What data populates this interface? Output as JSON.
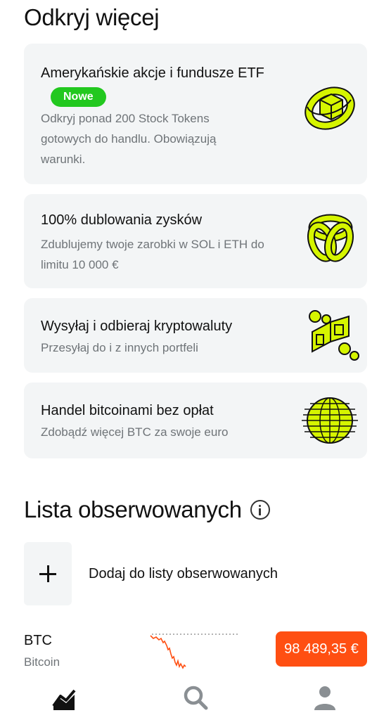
{
  "discover": {
    "title": "Odkryj więcej",
    "cards": [
      {
        "title": "Amerykańskie akcje i fundusze ETF",
        "badge": "Nowe",
        "description": "Odkryj ponad 200 Stock Tokens gotowych do handlu. Obowiązują warunki.",
        "icon": "cube-ring-icon"
      },
      {
        "title": "100% dublowania zysków",
        "description": "Zdublujemy twoje zarobki w SOL i ETH do limitu 10 000 €",
        "icon": "knot-icon"
      },
      {
        "title": "Wysyłaj i odbieraj kryptowaluty",
        "description": "Przesyłaj do i z innych portfeli",
        "icon": "transfer-blocks-icon"
      },
      {
        "title": "Handel bitcoinami bez opłat",
        "description": "Zdobądź więcej BTC za swoje euro",
        "icon": "striped-sphere-icon"
      }
    ]
  },
  "watchlist": {
    "title": "Lista obserwowanych",
    "add_label": "Dodaj do listy obserwowanych",
    "items": [
      {
        "symbol": "BTC",
        "name": "Bitcoin",
        "price": "98 489,35 €"
      }
    ]
  },
  "colors": {
    "accent_green": "#22c81f",
    "art_lime": "#d6f500",
    "price_down": "#ff4f12",
    "card_bg": "#f3f5f6"
  },
  "tabs": [
    {
      "icon": "portfolio-chart-icon"
    },
    {
      "icon": "search-icon"
    },
    {
      "icon": "profile-icon"
    }
  ]
}
